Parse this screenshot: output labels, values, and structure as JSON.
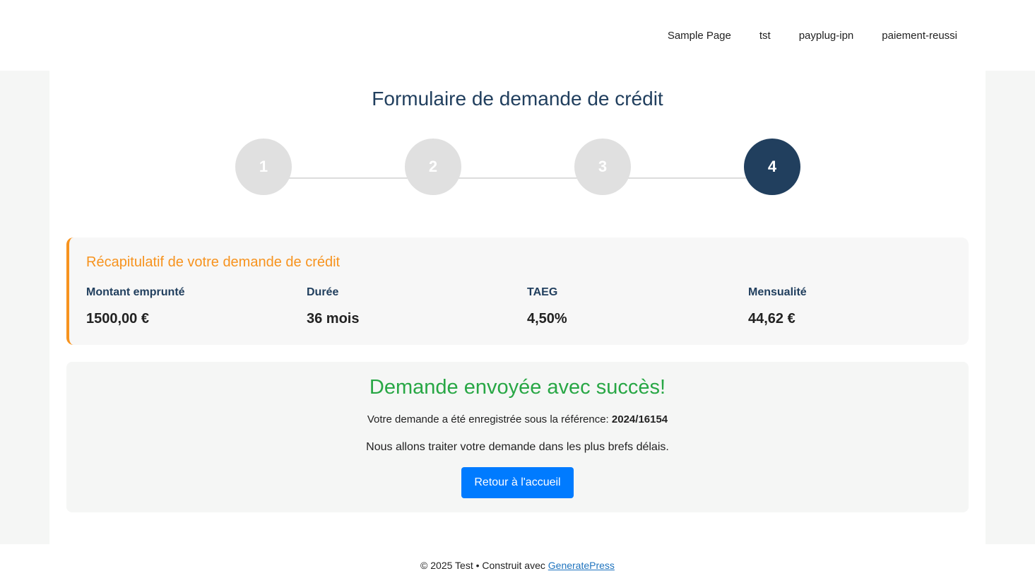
{
  "nav": {
    "items": [
      {
        "label": "Sample Page"
      },
      {
        "label": "tst"
      },
      {
        "label": "payplug-ipn"
      },
      {
        "label": "paiement-reussi"
      }
    ]
  },
  "form": {
    "title": "Formulaire de demande de crédit",
    "steps": [
      {
        "number": "1",
        "active": false
      },
      {
        "number": "2",
        "active": false
      },
      {
        "number": "3",
        "active": false
      },
      {
        "number": "4",
        "active": true
      }
    ]
  },
  "summary": {
    "title": "Récapitulatif de votre demande de crédit",
    "fields": [
      {
        "label": "Montant emprunté",
        "value": "1500,00 €"
      },
      {
        "label": "Durée",
        "value": "36 mois"
      },
      {
        "label": "TAEG",
        "value": "4,50%"
      },
      {
        "label": "Mensualité",
        "value": "44,62 €"
      }
    ]
  },
  "success": {
    "title": "Demande envoyée avec succès!",
    "ref_text": "Votre demande a été enregistrée sous la référence:",
    "ref_number": "2024/16154",
    "message": "Nous allons traiter votre demande dans les plus brefs délais.",
    "button_label": "Retour à l'accueil"
  },
  "footer": {
    "text": "© 2025 Test • Construit avec",
    "link_label": "GeneratePress"
  },
  "colors": {
    "primary_dark": "#213f5e",
    "accent_orange": "#f7931e",
    "success_green": "#28a745",
    "button_blue": "#007bff",
    "step_inactive": "#e0e0e0"
  }
}
